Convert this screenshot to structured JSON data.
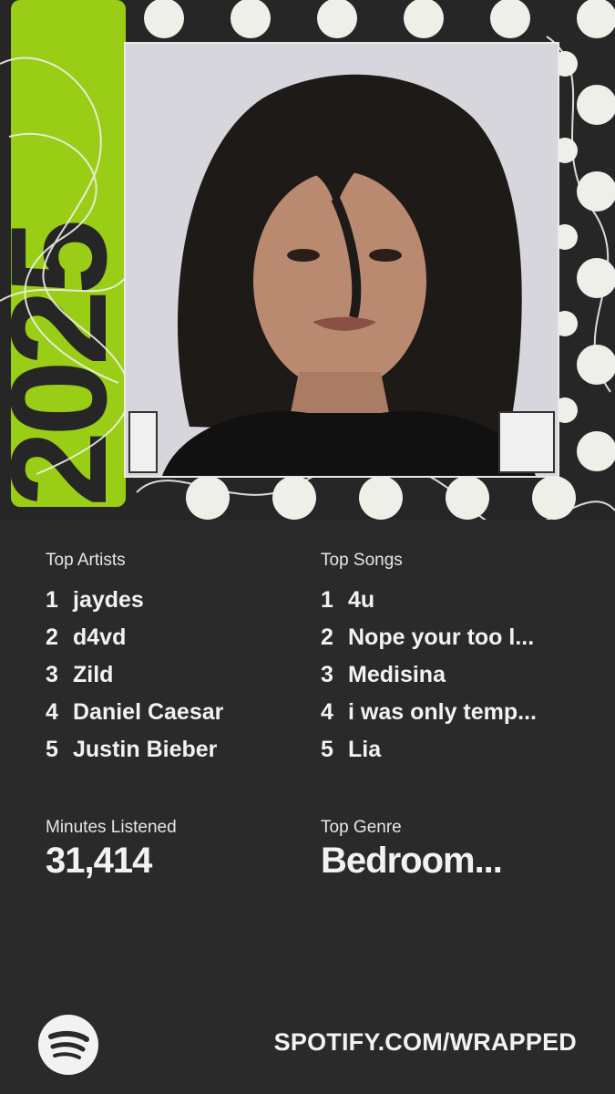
{
  "hero": {
    "year_text": "2025",
    "accent_color": "#9acd15",
    "dot_color": "#efefea",
    "photo_alt": "profile photo"
  },
  "top_artists": {
    "label": "Top Artists",
    "items": [
      {
        "rank": "1",
        "name": "jaydes"
      },
      {
        "rank": "2",
        "name": "d4vd"
      },
      {
        "rank": "3",
        "name": "Zild"
      },
      {
        "rank": "4",
        "name": "Daniel Caesar"
      },
      {
        "rank": "5",
        "name": "Justin Bieber"
      }
    ]
  },
  "top_songs": {
    "label": "Top Songs",
    "items": [
      {
        "rank": "1",
        "name": "4u"
      },
      {
        "rank": "2",
        "name": "Nope your too l..."
      },
      {
        "rank": "3",
        "name": "Medisina"
      },
      {
        "rank": "4",
        "name": "i was only temp..."
      },
      {
        "rank": "5",
        "name": "Lia"
      }
    ]
  },
  "minutes": {
    "label": "Minutes Listened",
    "value": "31,414"
  },
  "genre": {
    "label": "Top Genre",
    "value": "Bedroom..."
  },
  "footer": {
    "url": "SPOTIFY.COM/WRAPPED",
    "logo_icon": "spotify-logo-icon"
  }
}
